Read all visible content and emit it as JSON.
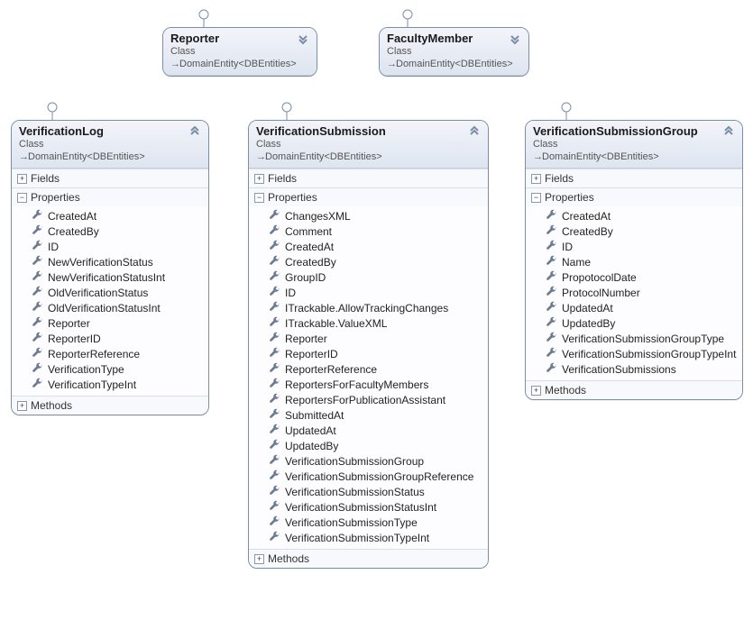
{
  "common": {
    "class_label": "Class",
    "inherits": "DomainEntity<DBEntities>",
    "sections": {
      "fields": "Fields",
      "properties": "Properties",
      "methods": "Methods"
    }
  },
  "boxes": {
    "reporter": {
      "title": "Reporter"
    },
    "faculty": {
      "title": "FacultyMember"
    },
    "vlog": {
      "title": "VerificationLog",
      "properties": [
        "CreatedAt",
        "CreatedBy",
        "ID",
        "NewVerificationStatus",
        "NewVerificationStatusInt",
        "OldVerificationStatus",
        "OldVerificationStatusInt",
        "Reporter",
        "ReporterID",
        "ReporterReference",
        "VerificationType",
        "VerificationTypeInt"
      ]
    },
    "vsub": {
      "title": "VerificationSubmission",
      "properties": [
        "ChangesXML",
        "Comment",
        "CreatedAt",
        "CreatedBy",
        "GroupID",
        "ID",
        "ITrackable.AllowTrackingChanges",
        "ITrackable.ValueXML",
        "Reporter",
        "ReporterID",
        "ReporterReference",
        "ReportersForFacultyMembers",
        "ReportersForPublicationAssistant",
        "SubmittedAt",
        "UpdatedAt",
        "UpdatedBy",
        "VerificationSubmissionGroup",
        "VerificationSubmissionGroupReference",
        "VerificationSubmissionStatus",
        "VerificationSubmissionStatusInt",
        "VerificationSubmissionType",
        "VerificationSubmissionTypeInt"
      ]
    },
    "vgroup": {
      "title": "VerificationSubmissionGroup",
      "properties": [
        "CreatedAt",
        "CreatedBy",
        "ID",
        "Name",
        "PropotocolDate",
        "ProtocolNumber",
        "UpdatedAt",
        "UpdatedBy",
        "VerificationSubmissionGroupType",
        "VerificationSubmissionGroupTypeInt",
        "VerificationSubmissions"
      ]
    }
  }
}
